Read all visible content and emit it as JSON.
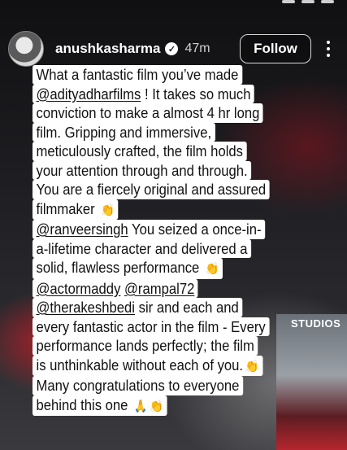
{
  "header": {
    "username": "anushkasharma",
    "verified_glyph": "✓",
    "time": "47m",
    "follow_label": "Follow"
  },
  "poster": {
    "label": "STUDIOS"
  },
  "caption": {
    "lines": [
      [
        {
          "t": "What a fantastic film you’ve made"
        }
      ],
      [
        {
          "t": "@adityadharfilms",
          "m": true
        },
        {
          "t": " ! It takes so much"
        }
      ],
      [
        {
          "t": "conviction to make a almost 4 hr long"
        }
      ],
      [
        {
          "t": "film. Gripping and immersive,"
        }
      ],
      [
        {
          "t": "meticulously crafted, the film holds"
        }
      ],
      [
        {
          "t": "your attention through and through."
        }
      ],
      [
        {
          "t": "You are a fiercely original and assured"
        }
      ],
      [
        {
          "t": "filmmaker "
        },
        {
          "e": "👏"
        }
      ],
      [
        {
          "t": "@ranveersingh",
          "m": true
        },
        {
          "t": "  You seized a once-in-"
        }
      ],
      [
        {
          "t": "a-lifetime character and delivered a"
        }
      ],
      [
        {
          "t": "solid, flawless performance "
        },
        {
          "e": "👏"
        }
      ],
      [
        {
          "t": "@actormaddy",
          "m": true
        },
        {
          "t": " "
        },
        {
          "t": "@rampal72",
          "m": true
        }
      ],
      [
        {
          "t": "@therakeshbedi",
          "m": true
        },
        {
          "t": " sir and each and"
        }
      ],
      [
        {
          "t": "every fantastic actor in the film - Every"
        }
      ],
      [
        {
          "t": "performance lands perfectly; the film"
        }
      ],
      [
        {
          "t": "is unthinkable without  each of you."
        },
        {
          "e": "👏"
        }
      ],
      [
        {
          "t": "Many congratulations to everyone"
        }
      ],
      [
        {
          "t": "behind this one "
        },
        {
          "e": "🙏"
        },
        {
          "e": "👏"
        }
      ]
    ]
  }
}
